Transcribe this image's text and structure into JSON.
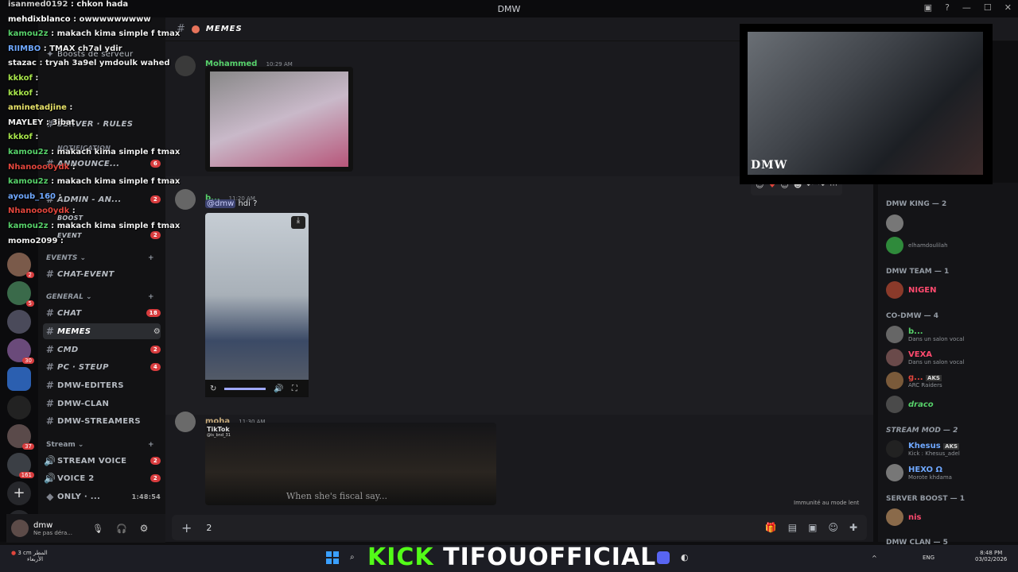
{
  "window": {
    "title": "DMW",
    "minimize": "—",
    "maximize": "☐",
    "close": "✕"
  },
  "channel": {
    "name": "MEMES",
    "hash": "#"
  },
  "servers": {
    "badges": [
      "2",
      "5",
      "30",
      "16",
      "37",
      "161"
    ]
  },
  "sidebar": {
    "items": [
      {
        "label": "Boosts de serveur",
        "badge": ""
      },
      {
        "label": "SERVER · RULES",
        "badge": ""
      },
      {
        "label": "NOTIFICATION",
        "badge": ""
      },
      {
        "label": "ANNOUNCE...",
        "badge": "6"
      },
      {
        "label": "ADMIN - AN...",
        "badge": "2"
      },
      {
        "label": "BOOST",
        "badge": ""
      },
      {
        "label": "EVENT",
        "badge": "2"
      }
    ],
    "cat_events": "EVENTS",
    "cat_general": "GENERAL",
    "cat_stream": "Stream",
    "chat_event": "CHAT-EVENT",
    "chat": "CHAT",
    "chat_badge": "18",
    "memes": "MEMES",
    "cmd": "CMD",
    "cmd_badge": "2",
    "pc": "PC · STEUP",
    "pc_badge": "4",
    "editers": "DMW-EDITERS",
    "clan": "DMW-CLAN",
    "streamers": "DMW-STREAMERS",
    "stream_voice": "STREAM VOICE",
    "stream_voice_badge": "2",
    "voice2": "VOICE 2",
    "voice2_badge": "2",
    "only": "ONLY · ...",
    "only_time": "1:48:54"
  },
  "user": {
    "name": "dmw",
    "status": "Ne pas déra..."
  },
  "messages": [
    {
      "author": "Mohammed",
      "time": "10:29 AM"
    },
    {
      "author": "b...",
      "time": "11:20 AM",
      "mention": "@dmw",
      "text": "hdi ?"
    },
    {
      "author": "moha",
      "time": "11:30 AM",
      "tiktok": "TikTok",
      "tiktok_user": "@is_bnd_31",
      "caption": "When she's fiscal say..."
    }
  ],
  "composer": {
    "value": "2",
    "slowmode": "Immunité au mode lent"
  },
  "members": {
    "groups": [
      {
        "title": "DMW KING — 2"
      },
      {
        "title": "DMW TEAM — 1"
      },
      {
        "title": "CO-DMW — 4"
      },
      {
        "title": "STREAM MOD — 2"
      },
      {
        "title": "SERVER BOOST — 1"
      },
      {
        "title": "DMW CLAN — 5"
      }
    ],
    "m1_sub": "elhamdoulilah",
    "nigen": "NIGEN",
    "b": "b...",
    "b_sub": "Dans un salon vocal",
    "vexa": "VEXA",
    "vexa_sub": "Dans un salon vocal",
    "g": "g...",
    "g_tag": "AKS",
    "g_sub": "ARC Raiders",
    "draco": "draco",
    "khesus": "Khesus",
    "khesus_tag": "AKS",
    "khesus_sub": "Kick : Khesus_adel",
    "hexo": "HEXO Ω",
    "hexo_sub": "Morote khdama",
    "nis": "nis"
  },
  "overlay_chat": [
    {
      "user": "isanmed0192",
      "msg": "chkon hada",
      "color": "#cccccc"
    },
    {
      "user": "mehdixblanco",
      "msg": "owwwwwwwww",
      "color": "#ffffff"
    },
    {
      "user": "kamou2z",
      "msg": "makach kima simple f tmax",
      "color": "#57d16a"
    },
    {
      "user": "RIIMBO",
      "msg": "TMAX ch7al ydir",
      "color": "#6fa8ff"
    },
    {
      "user": "stazac",
      "msg": "tryah 3a9el ymdoulk wahed",
      "color": "#eeeeee"
    },
    {
      "user": "kkkof",
      "msg": "",
      "color": "#a6e34a"
    },
    {
      "user": "kkkof",
      "msg": "",
      "color": "#a6e34a"
    },
    {
      "user": "aminetadjine",
      "msg": "",
      "color": "#e8e26a"
    },
    {
      "user": "MAYLEY",
      "msg": "3ibat",
      "color": "#eeeeee"
    },
    {
      "user": "kkkof",
      "msg": "",
      "color": "#a6e34a"
    },
    {
      "user": "kamou2z",
      "msg": "makach kima simple f tmax",
      "color": "#57d16a"
    },
    {
      "user": "Nhanooo0ydk",
      "msg": "",
      "color": "#e0453c"
    },
    {
      "user": "kamou2z",
      "msg": "makach kima simple f tmax",
      "color": "#57d16a"
    },
    {
      "user": "ayoub_160",
      "msg": "",
      "color": "#6fa8ff"
    },
    {
      "user": "Nhanooo0ydk",
      "msg": "",
      "color": "#e0453c"
    },
    {
      "user": "kamou2z",
      "msg": "makach kima simple f tmax",
      "color": "#57d16a"
    },
    {
      "user": "momo2099",
      "msg": "",
      "color": "#eeeeee"
    }
  ],
  "stream": {
    "kick": "KICK",
    "channel": "TIFOUOFFICIAL",
    "cam_logo": "DMW"
  },
  "taskbar": {
    "weather": "3 cm المطر",
    "weather_sub": "الأربعاء",
    "lang": "ENG",
    "time": "8:48 PM",
    "date": "03/02/2026"
  },
  "colors": {
    "kick_green": "#53fc18",
    "mohammed": "#57d16a",
    "moha": "#c4a87a",
    "draco": "#57d16a",
    "nigen": "#ff4a6e",
    "vexa": "#ff4a6e",
    "khesus": "#6fa8ff",
    "hexo": "#6fa8ff"
  }
}
